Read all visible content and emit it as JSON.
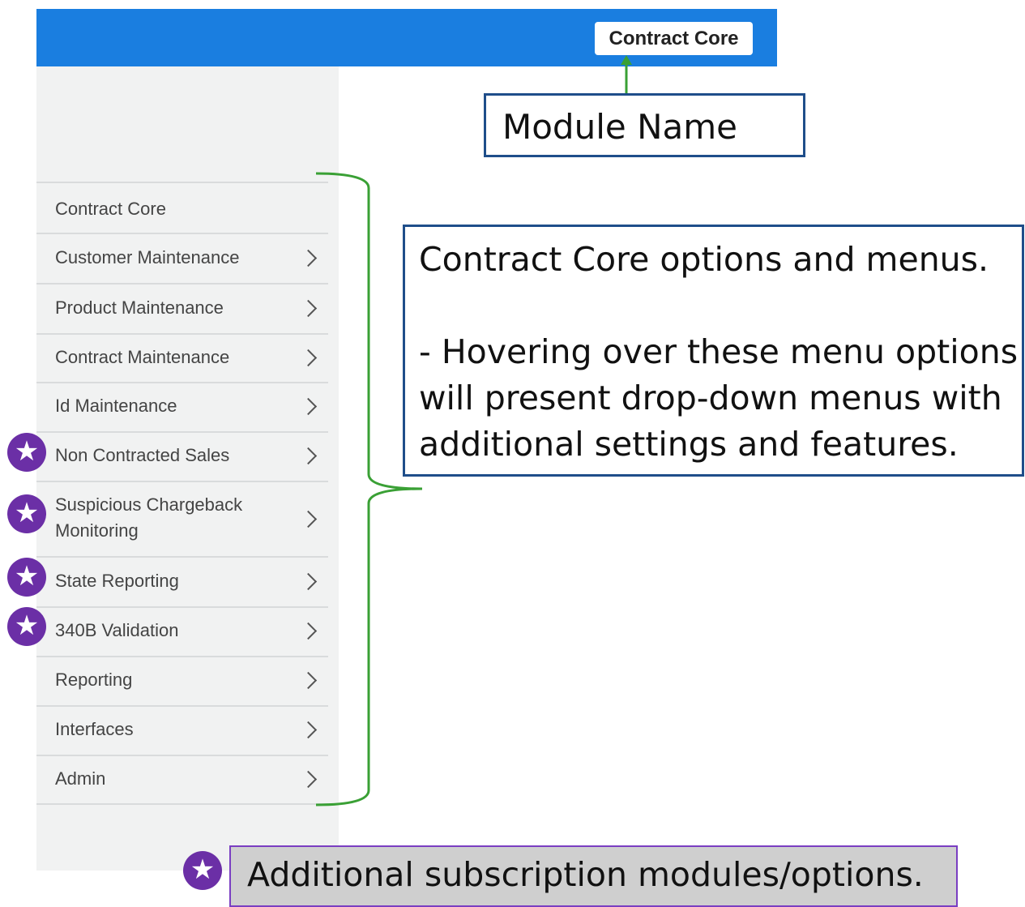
{
  "header": {
    "module_name": "Contract Core"
  },
  "sidebar": {
    "items": [
      {
        "label": "Contract Core",
        "has_submenu": false,
        "premium": false
      },
      {
        "label": "Customer Maintenance",
        "has_submenu": true,
        "premium": false
      },
      {
        "label": "Product Maintenance",
        "has_submenu": true,
        "premium": false
      },
      {
        "label": "Contract Maintenance",
        "has_submenu": true,
        "premium": false
      },
      {
        "label": "Id Maintenance",
        "has_submenu": true,
        "premium": false
      },
      {
        "label": "Non Contracted Sales",
        "has_submenu": true,
        "premium": true
      },
      {
        "label": "Suspicious Chargeback Monitoring",
        "has_submenu": true,
        "premium": true
      },
      {
        "label": "State Reporting",
        "has_submenu": true,
        "premium": true
      },
      {
        "label": "340B Validation",
        "has_submenu": true,
        "premium": true
      },
      {
        "label": "Reporting",
        "has_submenu": true,
        "premium": false
      },
      {
        "label": "Interfaces",
        "has_submenu": true,
        "premium": false
      },
      {
        "label": "Admin",
        "has_submenu": true,
        "premium": false
      }
    ]
  },
  "annotations": {
    "module_name_label": "Module Name",
    "menus_title": "Contract Core options and menus.",
    "menus_detail": "- Hovering over these menu options will present drop-down menus with additional settings and features.",
    "legend_text": "Additional subscription modules/options."
  },
  "colors": {
    "topbar": "#1a7ee0",
    "premium_star": "#6b2fa6",
    "callout_border": "#1f4e8a",
    "bracket": "#3aa035"
  },
  "icons": {
    "premium": "star-icon",
    "submenu": "chevron-right-icon"
  }
}
